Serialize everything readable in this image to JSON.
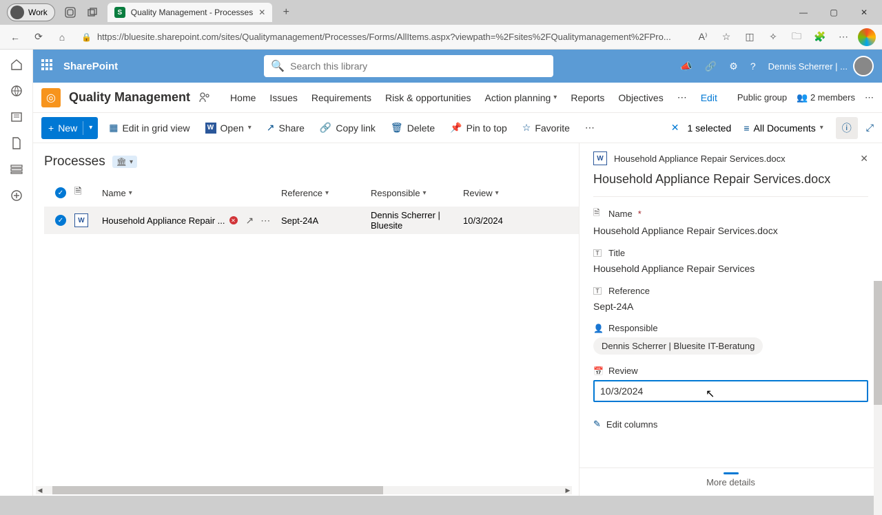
{
  "browser": {
    "profile_label": "Work",
    "tab_title": "Quality Management - Processes",
    "url": "https://bluesite.sharepoint.com/sites/Qualitymanagement/Processes/Forms/AllItems.aspx?viewpath=%2Fsites%2FQualitymanagement%2FPro..."
  },
  "suite": {
    "brand": "SharePoint",
    "search_placeholder": "Search this library",
    "user_display": "Dennis Scherrer | ..."
  },
  "site": {
    "name": "Quality Management",
    "nav": [
      "Home",
      "Issues",
      "Requirements",
      "Risk & opportunities",
      "Action planning",
      "Reports",
      "Objectives"
    ],
    "edit": "Edit",
    "group": "Public group",
    "members": "2 members"
  },
  "cmd": {
    "new": "New",
    "edit_grid": "Edit in grid view",
    "open": "Open",
    "share": "Share",
    "copy": "Copy link",
    "delete": "Delete",
    "pin": "Pin to top",
    "favorite": "Favorite",
    "selected": "1 selected",
    "view": "All Documents"
  },
  "list": {
    "title": "Processes",
    "cols": {
      "name": "Name",
      "reference": "Reference",
      "responsible": "Responsible",
      "review": "Review"
    },
    "rows": [
      {
        "name": "Household Appliance Repair ...",
        "reference": "Sept-24A",
        "responsible": "Dennis Scherrer | Bluesite",
        "review": "10/3/2024"
      }
    ]
  },
  "details": {
    "file_name_header": "Household Appliance Repair Services.docx",
    "title_heading": "Household Appliance Repair Services.docx",
    "fields": {
      "name_label": "Name",
      "name_value": "Household Appliance Repair Services.docx",
      "title_label": "Title",
      "title_value": "Household Appliance Repair Services",
      "reference_label": "Reference",
      "reference_value": "Sept-24A",
      "responsible_label": "Responsible",
      "responsible_value": "Dennis Scherrer | Bluesite IT-Beratung",
      "review_label": "Review",
      "review_value": "10/3/2024"
    },
    "edit_columns": "Edit columns",
    "more_details": "More details"
  }
}
